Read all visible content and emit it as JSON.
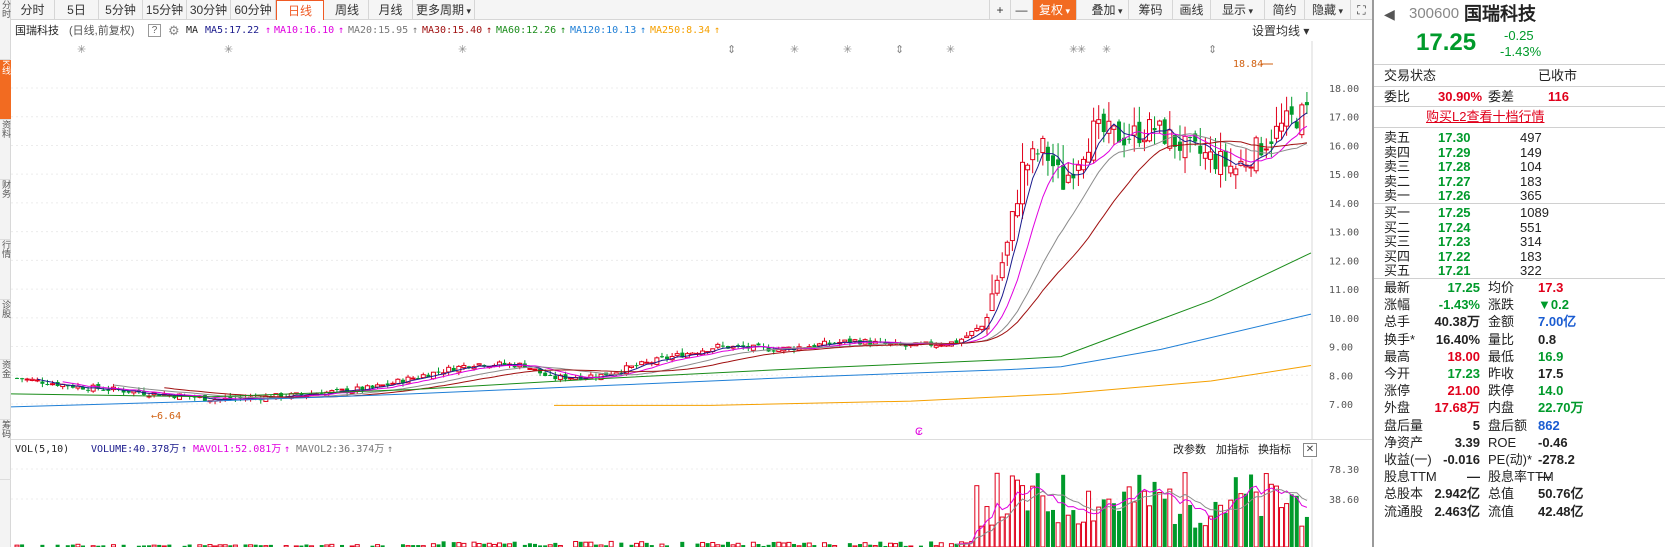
{
  "sidebar": {
    "tabs": [
      "分时",
      "K线",
      "资料",
      "财务",
      "行情",
      "诊股",
      "资金",
      "筹码"
    ]
  },
  "toolbar": {
    "periods": [
      "分时",
      "5日",
      "5分钟",
      "15分钟",
      "30分钟",
      "60分钟",
      "日线",
      "周线",
      "月线",
      "更多周期"
    ],
    "active_period": "日线",
    "right_buttons": [
      "复权",
      "叠加",
      "筹码",
      "画线",
      "显示",
      "简约",
      "隐藏"
    ],
    "plus": "+",
    "minus": "—"
  },
  "info": {
    "stock_name": "国瑞科技",
    "mode": "(日线,前复权)",
    "help": "?",
    "ma_label": "MA",
    "ma5": "MA5:17.22",
    "ma10": "MA10:16.10",
    "ma20": "MA20:15.95",
    "ma30": "MA30:15.40",
    "ma60": "MA60:12.26",
    "ma120": "MA120:10.13",
    "ma250": "MA250:8.34",
    "setting": "设置均线"
  },
  "chart_data": {
    "type": "candlestick",
    "y_ticks": [
      "18.00",
      "17.00",
      "16.00",
      "15.00",
      "14.00",
      "13.00",
      "12.00",
      "11.00",
      "10.00",
      "9.00",
      "8.00",
      "7.00"
    ],
    "ylim": [
      6.5,
      19.5
    ],
    "max_label": "18.84",
    "min_label": "6.64",
    "colors": {
      "ma5": "#1a1a8c",
      "ma10": "#e000e0",
      "ma20": "#8c8c8c",
      "ma30": "#a01010",
      "ma60": "#1a8c1a",
      "ma120": "#1f7fd6",
      "ma250": "#f5a000",
      "up": "#e0001b",
      "down": "#009a2b"
    }
  },
  "volume": {
    "label": "VOL(5,10)",
    "volume": "VOLUME:40.378万",
    "mavol1": "MAVOL1:52.081万",
    "mavol2": "MAVOL2:36.374万",
    "btn_params": "改参数",
    "btn_add": "加指标",
    "btn_switch": "换指标",
    "close": "✕",
    "y_ticks": [
      "78.30",
      "38.60"
    ]
  },
  "quote": {
    "code": "300600",
    "name": "国瑞科技",
    "price": "17.25",
    "change": "-0.25",
    "pct": "-1.43%",
    "status_label": "交易状态",
    "status_value": "已收市",
    "weibi_label": "委比",
    "weibi_value": "30.90%",
    "weicha_label": "委差",
    "weicha_value": "116",
    "l2_link": "购买L2查看十档行情",
    "sells": [
      {
        "label": "卖五",
        "price": "17.30",
        "vol": "497"
      },
      {
        "label": "卖四",
        "price": "17.29",
        "vol": "149"
      },
      {
        "label": "卖三",
        "price": "17.28",
        "vol": "104"
      },
      {
        "label": "卖二",
        "price": "17.27",
        "vol": "183"
      },
      {
        "label": "卖一",
        "price": "17.26",
        "vol": "365"
      }
    ],
    "buys": [
      {
        "label": "买一",
        "price": "17.25",
        "vol": "1089"
      },
      {
        "label": "买二",
        "price": "17.24",
        "vol": "551"
      },
      {
        "label": "买三",
        "price": "17.23",
        "vol": "314"
      },
      {
        "label": "买四",
        "price": "17.22",
        "vol": "183"
      },
      {
        "label": "买五",
        "price": "17.21",
        "vol": "322"
      }
    ],
    "stats": [
      {
        "l1": "最新",
        "v1": "17.25",
        "c1": "green",
        "l2": "均价",
        "v2": "17.3",
        "c2": "red"
      },
      {
        "l1": "涨幅",
        "v1": "-1.43%",
        "c1": "green",
        "l2": "涨跌",
        "v2": "▼0.2",
        "c2": "green"
      },
      {
        "l1": "总手",
        "v1": "40.38万",
        "c1": "",
        "l2": "金额",
        "v2": "7.00亿",
        "c2": "blue"
      },
      {
        "l1": "换手*",
        "v1": "16.40%",
        "c1": "",
        "l2": "量比",
        "v2": "0.8",
        "c2": ""
      },
      {
        "l1": "最高",
        "v1": "18.00",
        "c1": "red",
        "l2": "最低",
        "v2": "16.9",
        "c2": "green"
      },
      {
        "l1": "今开",
        "v1": "17.23",
        "c1": "green",
        "l2": "昨收",
        "v2": "17.5",
        "c2": ""
      },
      {
        "l1": "涨停",
        "v1": "21.00",
        "c1": "red",
        "l2": "跌停",
        "v2": "14.0",
        "c2": "green"
      },
      {
        "l1": "外盘",
        "v1": "17.68万",
        "c1": "red",
        "l2": "内盘",
        "v2": "22.70万",
        "c2": "green"
      },
      {
        "l1": "盘后量",
        "v1": "5",
        "c1": "",
        "l2": "盘后额",
        "v2": "862",
        "c2": "blue"
      },
      {
        "l1": "净资产",
        "v1": "3.39",
        "c1": "",
        "l2": "ROE",
        "v2": "-0.46",
        "c2": ""
      },
      {
        "l1": "收益(一)",
        "v1": "-0.016",
        "c1": "",
        "l2": "PE(动)*",
        "v2": "-278.2",
        "c2": ""
      },
      {
        "l1": "股息TTM",
        "v1": "—",
        "c1": "",
        "l2": "股息率TTM",
        "v2": "—",
        "c2": ""
      },
      {
        "l1": "总股本",
        "v1": "2.942亿",
        "c1": "",
        "l2": "总值",
        "v2": "50.76亿",
        "c2": ""
      },
      {
        "l1": "流通股",
        "v1": "2.463亿",
        "c1": "",
        "l2": "流值",
        "v2": "42.48亿",
        "c2": ""
      }
    ]
  }
}
